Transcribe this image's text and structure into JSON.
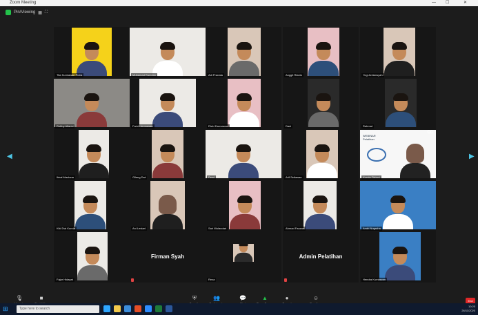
{
  "window": {
    "title": "Zoom Meeting",
    "minimize": "—",
    "maximize": "☐",
    "close": "✕"
  },
  "topbar": {
    "label": "Pin/Viewing",
    "icons": [
      "grid-icon",
      "fullscreen-icon"
    ]
  },
  "colors": {
    "accent_green": "#23c24a",
    "end_red": "#e02828",
    "nav_arrow": "#4ec6e6",
    "taskbar": "#0f1a2e"
  },
  "tiles": [
    {
      "id": "r1c1",
      "name": "Tita Kurniawan Putra",
      "bg": "yellow",
      "type": "person"
    },
    {
      "id": "r1c2",
      "name": "Muhamad Ramdan",
      "bg": "white",
      "type": "person"
    },
    {
      "id": "r1c3",
      "name": "Adi Pranata",
      "bg": "warm",
      "type": "person"
    },
    {
      "id": "r1c4",
      "name": "Anggit Rianto",
      "bg": "pink",
      "type": "person"
    },
    {
      "id": "r1c5",
      "name": "Yogi Ardiansyah",
      "bg": "warm",
      "type": "person"
    },
    {
      "id": "r2c1",
      "name": "Robby Alfarizi",
      "bg": "gray",
      "type": "person"
    },
    {
      "id": "r2c2",
      "name": "Farid Hermawan",
      "bg": "white",
      "type": "person"
    },
    {
      "id": "r2c3",
      "name": "Rizki Darmawan",
      "bg": "pink",
      "type": "person"
    },
    {
      "id": "r2c4",
      "name": "Dani",
      "bg": "dark",
      "type": "person"
    },
    {
      "id": "r2c5",
      "name": "Rahmat",
      "bg": "dark",
      "type": "person"
    },
    {
      "id": "r3c1",
      "name": "Ikbal Maulana",
      "bg": "white",
      "type": "person"
    },
    {
      "id": "r3c2",
      "name": "Gilang Dwi",
      "bg": "warm",
      "type": "person"
    },
    {
      "id": "r3c3",
      "name": "Dewi",
      "bg": "white",
      "type": "person"
    },
    {
      "id": "r3c4",
      "name": "Arif Setiawan",
      "bg": "warm",
      "type": "person"
    },
    {
      "id": "r3c5",
      "name": "Kurnia Fitriani",
      "bg": "slide",
      "type": "slide"
    },
    {
      "id": "r4c1",
      "name": "Kiki Dwi Kurnia",
      "bg": "white",
      "type": "person"
    },
    {
      "id": "r4c2",
      "name": "Ani Lestari",
      "bg": "warm",
      "type": "hijab"
    },
    {
      "id": "r4c3",
      "name": "Sari Wulandari",
      "bg": "pink",
      "type": "person"
    },
    {
      "id": "r4c4",
      "name": "Ahmad Fauzan",
      "bg": "white",
      "type": "person"
    },
    {
      "id": "r4c5",
      "name": "Andri Nugraha",
      "bg": "blue",
      "type": "person"
    },
    {
      "id": "r5c1",
      "name": "Fajar Hidayat",
      "bg": "white",
      "type": "person"
    },
    {
      "id": "r5c2",
      "name": "Firman Syah",
      "bg": "dark",
      "type": "name"
    },
    {
      "id": "r5c3",
      "name": "Reza",
      "bg": "dark",
      "type": "small"
    },
    {
      "id": "r5c4",
      "name": "Admin Pelatihan",
      "bg": "dark",
      "type": "name"
    },
    {
      "id": "r5c5",
      "name": "Hendra Kurniawan",
      "bg": "blue",
      "type": "person"
    }
  ],
  "name_labels": {
    "r5c2": "Firman Syah",
    "r5c4": "Admin Pelatihan"
  },
  "slide": {
    "title_line1": "WEBINAR",
    "title_line2": "Pelatihan"
  },
  "cc_badge": "CC",
  "controls": [
    {
      "id": "mute",
      "icon": "🎙",
      "label": "Unmute"
    },
    {
      "id": "video",
      "icon": "■",
      "label": "Start Video"
    },
    {
      "id": "security",
      "icon": "⛨",
      "label": "Security"
    },
    {
      "id": "participants",
      "icon": "👥",
      "label": "Participants"
    },
    {
      "id": "chat",
      "icon": "💬",
      "label": "Chat"
    },
    {
      "id": "share",
      "icon": "▲",
      "label": "Share Screen"
    },
    {
      "id": "record",
      "icon": "●",
      "label": "Record"
    },
    {
      "id": "reactions",
      "icon": "☺",
      "label": "Reactions"
    }
  ],
  "end_label": "End",
  "taskbar": {
    "search_placeholder": "Type here to search",
    "time": "10:20",
    "date": "26/11/2020"
  }
}
